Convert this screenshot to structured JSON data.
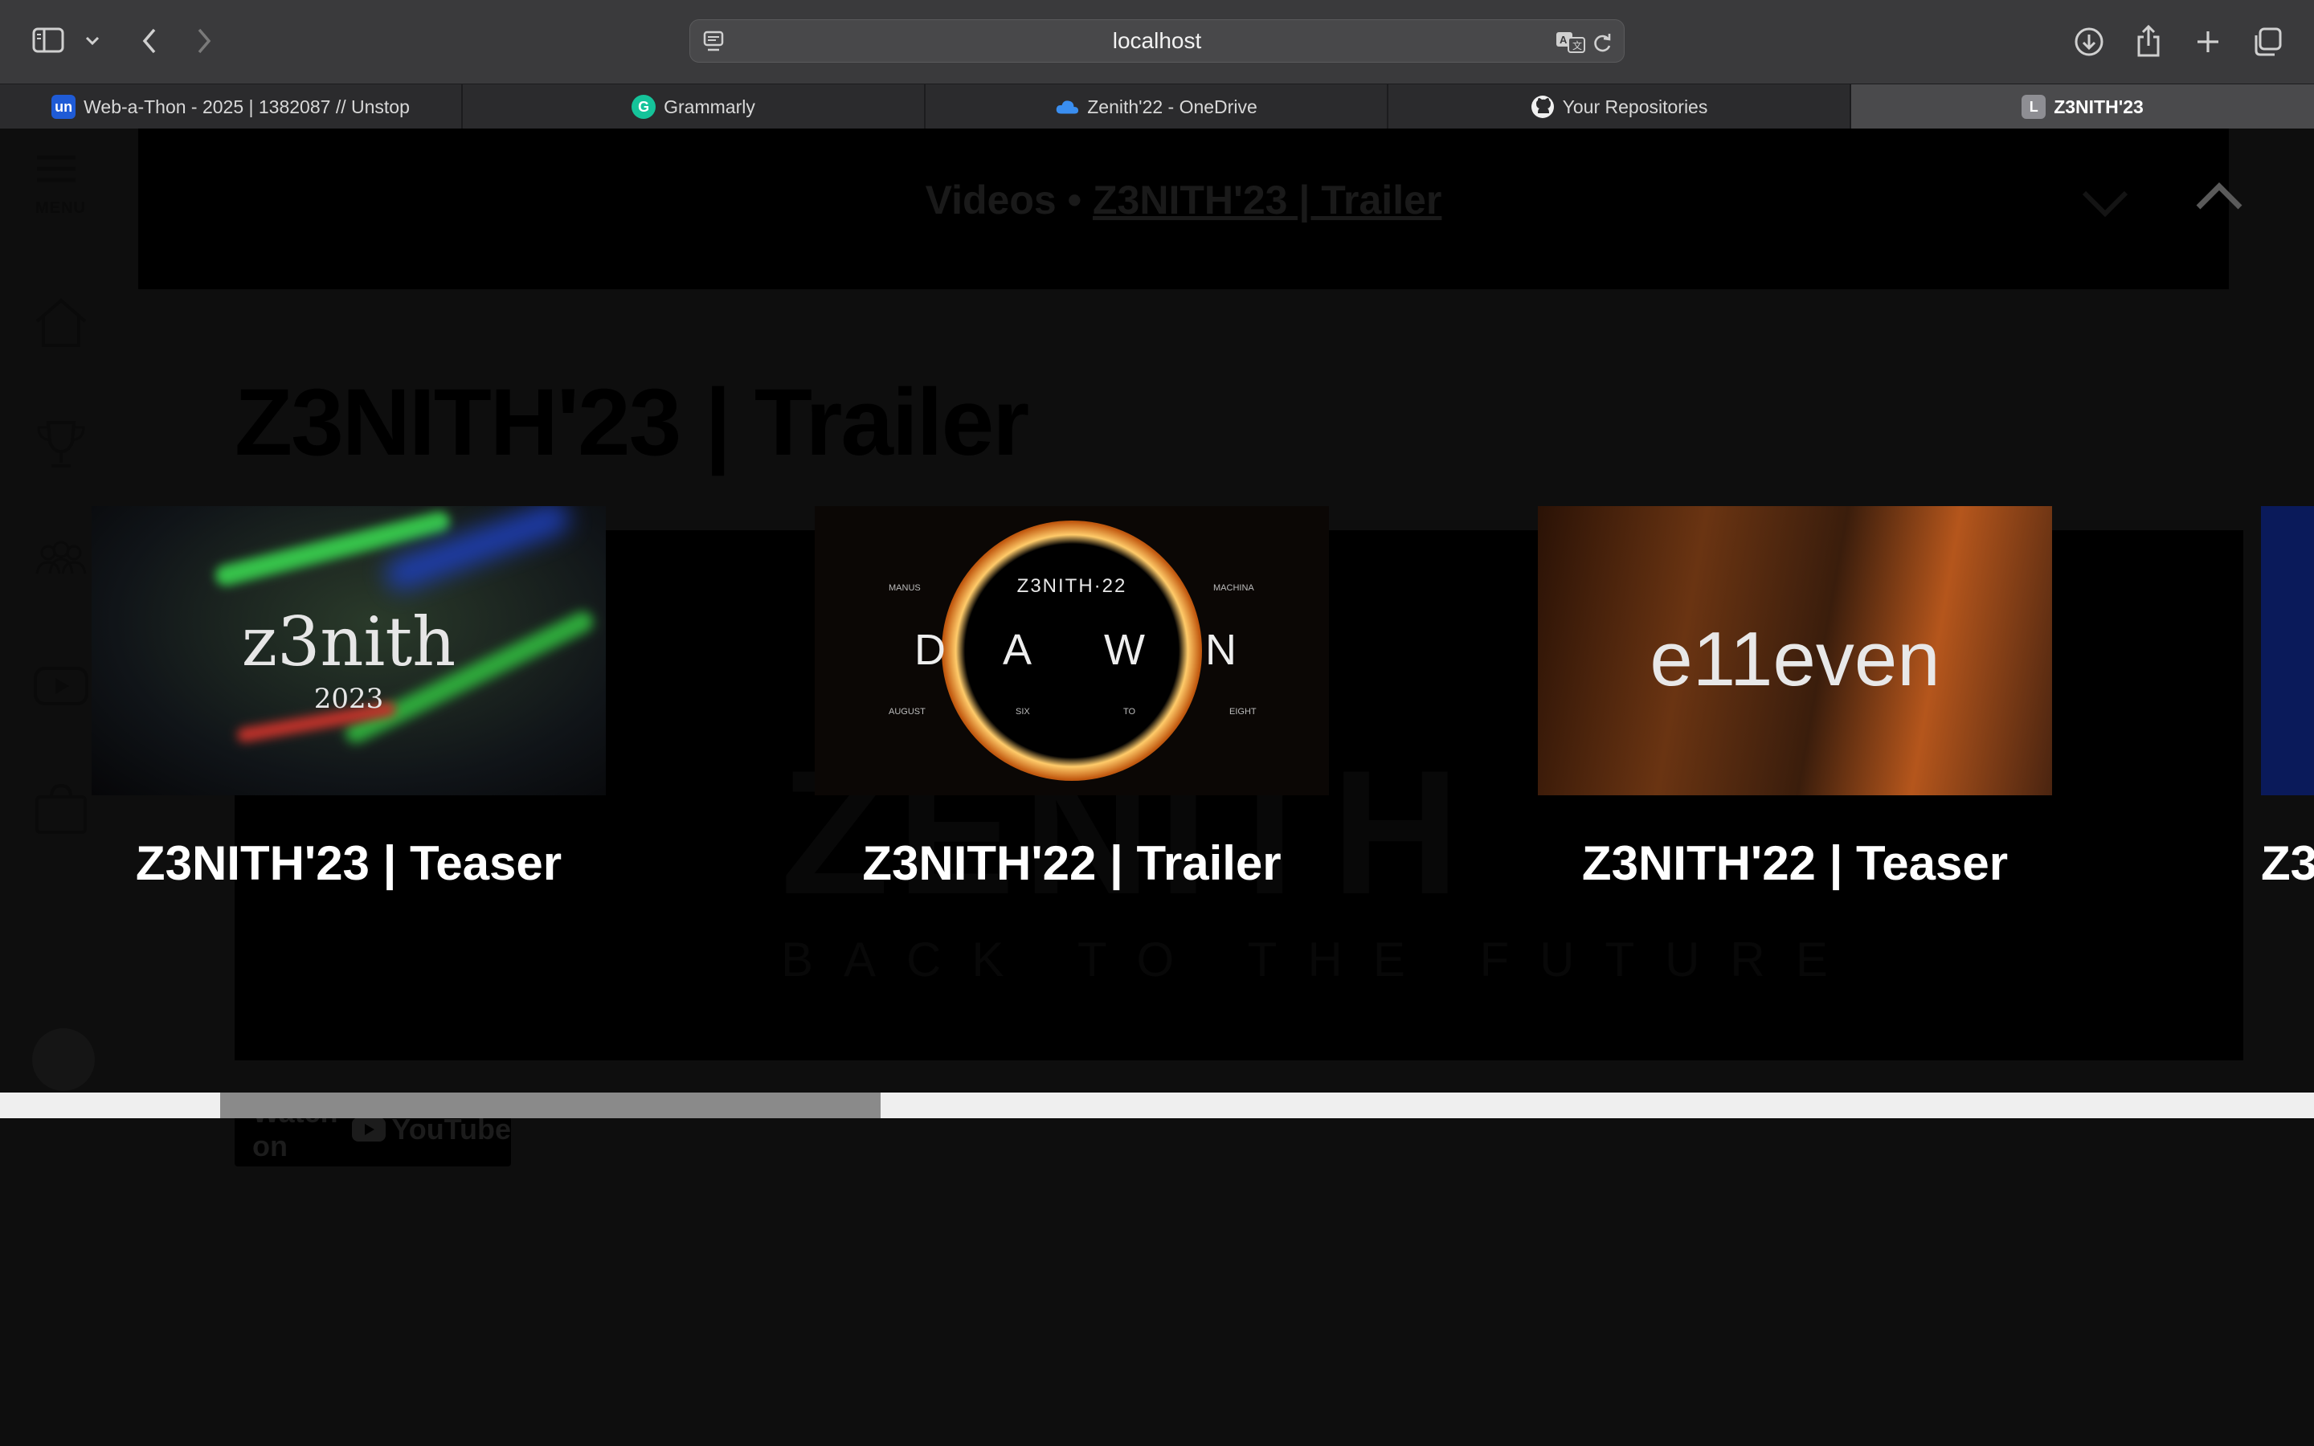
{
  "browser": {
    "url": "localhost",
    "tabs": [
      {
        "label": "Web-a-Thon - 2025 | 1382087 // Unstop",
        "favicon": "un",
        "active": false
      },
      {
        "label": "Grammarly",
        "favicon": "G",
        "active": false
      },
      {
        "label": "Zenith'22 - OneDrive",
        "favicon": "cloud",
        "active": false
      },
      {
        "label": "Your Repositories",
        "favicon": "github",
        "active": false
      },
      {
        "label": "Z3NITH'23",
        "favicon": "L",
        "active": true
      }
    ]
  },
  "sidebar": {
    "menu_label": "MENU",
    "items": [
      "home-icon",
      "trophy-icon",
      "team-icon",
      "youtube-icon",
      "bag-icon",
      "avatar-icon"
    ]
  },
  "banner": {
    "prefix": "Videos •",
    "current": "Z3NITH'23 | Trailer"
  },
  "page": {
    "title": "Z3NITH'23 | Trailer",
    "watch_on": "Watch on",
    "watch_brand": "YouTube",
    "background_logo": "ZENITH",
    "background_tagline": "BACK TO THE FUTURE"
  },
  "videos": [
    {
      "title": "Z3NITH'23 | Teaser",
      "thumb_main": "z3nith",
      "thumb_sub": "2023"
    },
    {
      "title": "Z3NITH'22 | Trailer",
      "thumb_main": "Z3NITH·22",
      "thumb_letters": [
        "D",
        "A",
        "W",
        "N"
      ],
      "thumb_words_top": [
        "MANUS",
        "MACHINA"
      ],
      "thumb_words_bottom": [
        "AUGUST",
        "SIX",
        "TO",
        "EIGHT"
      ]
    },
    {
      "title": "Z3NITH'22 | Teaser",
      "thumb_main": "e11even"
    },
    {
      "title": "Z3",
      "thumb_main": ""
    }
  ],
  "colors": {
    "page_bg": "#0e0e0e",
    "chrome_bg": "#3a3a3c",
    "active_tab": "#4a4a4c",
    "scrollbar_track": "#efefef",
    "scrollbar_thumb": "#8a8a8a"
  }
}
